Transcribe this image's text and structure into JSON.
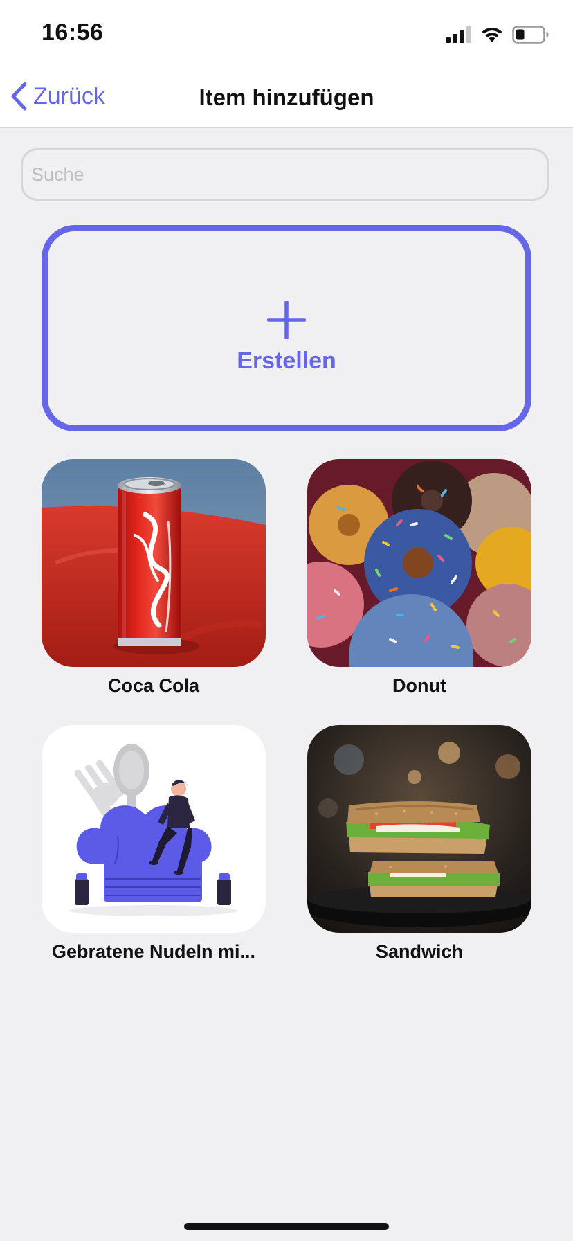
{
  "status_bar": {
    "time": "16:56",
    "icons": [
      "cellular-signal-icon",
      "wifi-icon",
      "battery-icon"
    ]
  },
  "nav": {
    "back_label": "Zurück",
    "title": "Item hinzufügen"
  },
  "search": {
    "placeholder": "Suche",
    "value": ""
  },
  "create": {
    "label": "Erstellen",
    "icon": "plus-icon"
  },
  "items": [
    {
      "name": "Coca Cola",
      "image": "coca-cola-can-photo"
    },
    {
      "name": "Donut",
      "image": "donuts-photo"
    },
    {
      "name": "Gebratene Nudeln mi...",
      "image": "chef-hat-illustration"
    },
    {
      "name": "Sandwich",
      "image": "sandwich-photo"
    }
  ],
  "colors": {
    "accent": "#6666e8",
    "background": "#f0f0f2",
    "text": "#111111"
  }
}
